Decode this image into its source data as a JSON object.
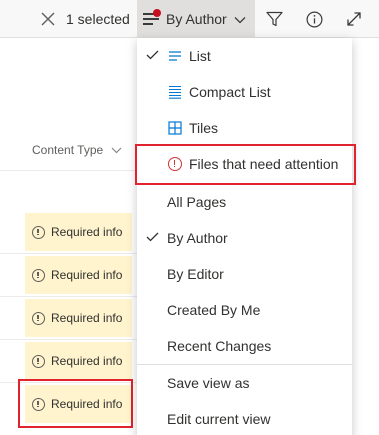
{
  "command_bar": {
    "selection_label": "1 selected",
    "view_label": "By Author",
    "icons": [
      "close-icon",
      "view-options-icon",
      "chevron-down-icon",
      "filter-icon",
      "info-icon",
      "expand-icon"
    ],
    "notification_dot_color": "#c50f1f"
  },
  "list": {
    "column_header": "Content Type",
    "rows": [
      {
        "status": "Required info"
      },
      {
        "status": "Required info"
      },
      {
        "status": "Required info"
      },
      {
        "status": "Required info"
      },
      {
        "status": "Required info"
      }
    ],
    "status_color": "#fff4ce"
  },
  "view_menu": {
    "items": [
      {
        "label": "List",
        "checked": true,
        "icon": "list-icon"
      },
      {
        "label": "Compact List",
        "checked": false,
        "icon": "compact-list-icon"
      },
      {
        "label": "Tiles",
        "checked": false,
        "icon": "tiles-icon"
      },
      {
        "label": "Files that need attention",
        "checked": false,
        "icon": "attention-icon"
      },
      {
        "label": "All Pages",
        "checked": false
      },
      {
        "label": "By Author",
        "checked": true
      },
      {
        "label": "By Editor",
        "checked": false
      },
      {
        "label": "Created By Me",
        "checked": false
      },
      {
        "label": "Recent Changes",
        "checked": false
      },
      {
        "label": "Save view as",
        "checked": false
      },
      {
        "label": "Edit current view",
        "checked": false
      }
    ],
    "accent_color": "#0078d4",
    "highlight_color": "#e0232e"
  }
}
